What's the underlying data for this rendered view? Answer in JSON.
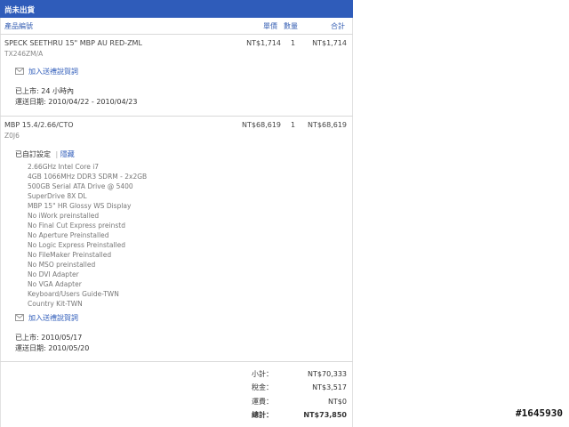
{
  "header": {
    "title": "尚未出貨"
  },
  "columns": {
    "product": "產品編號",
    "price": "單價",
    "qty": "數量",
    "total": "合計"
  },
  "items": [
    {
      "name": "SPECK SEETHRU 15\" MBP AU RED-ZML",
      "code": "TX246ZM/A",
      "price": "NT$1,714",
      "qty": "1",
      "total": "NT$1,714",
      "gift_link": "加入送禮說賀詞",
      "ship_label": "已上市: 24 小時內",
      "delivery_label": "運送日期: 2010/04/22 - 2010/04/23"
    },
    {
      "name": "MBP 15.4/2.66/CTO",
      "code": "Z0J6",
      "price": "NT$68,619",
      "qty": "1",
      "total": "NT$68,619",
      "config_label": "已自訂設定",
      "config_sep": "|",
      "config_hide": "隱藏",
      "specs": [
        "2.66GHz Intel Core i7",
        "4GB 1066MHz DDR3 SDRM - 2x2GB",
        "500GB Serial ATA Drive @ 5400",
        "SuperDrive 8X DL",
        "MBP 15\" HR Glossy WS Display",
        "No iWork preinstalled",
        "No Final Cut Express preinstd",
        "No Aperture Preinstalled",
        "No Logic Express Preinstalled",
        "No FileMaker Preinstalled",
        "No MSO preinstalled",
        "No DVI Adapter",
        "No VGA Adapter",
        "Keyboard/Users Guide-TWN",
        "Country Kit-TWN"
      ],
      "gift_link": "加入送禮說賀詞",
      "ship_label": "已上市: 2010/05/17",
      "delivery_label": "運送日期: 2010/05/20"
    }
  ],
  "summary": {
    "subtotal_label": "小計：",
    "subtotal": "NT$70,333",
    "tax_label": "稅金：",
    "tax": "NT$3,517",
    "shipping_label": "運費：",
    "shipping": "NT$0",
    "total_label": "總計：",
    "total": "NT$73,850"
  },
  "watermark": "#1645930",
  "icons": {
    "gift": "gift-envelope-icon"
  },
  "colors": {
    "header_bg": "#2f5cba",
    "link": "#2f5cba"
  }
}
